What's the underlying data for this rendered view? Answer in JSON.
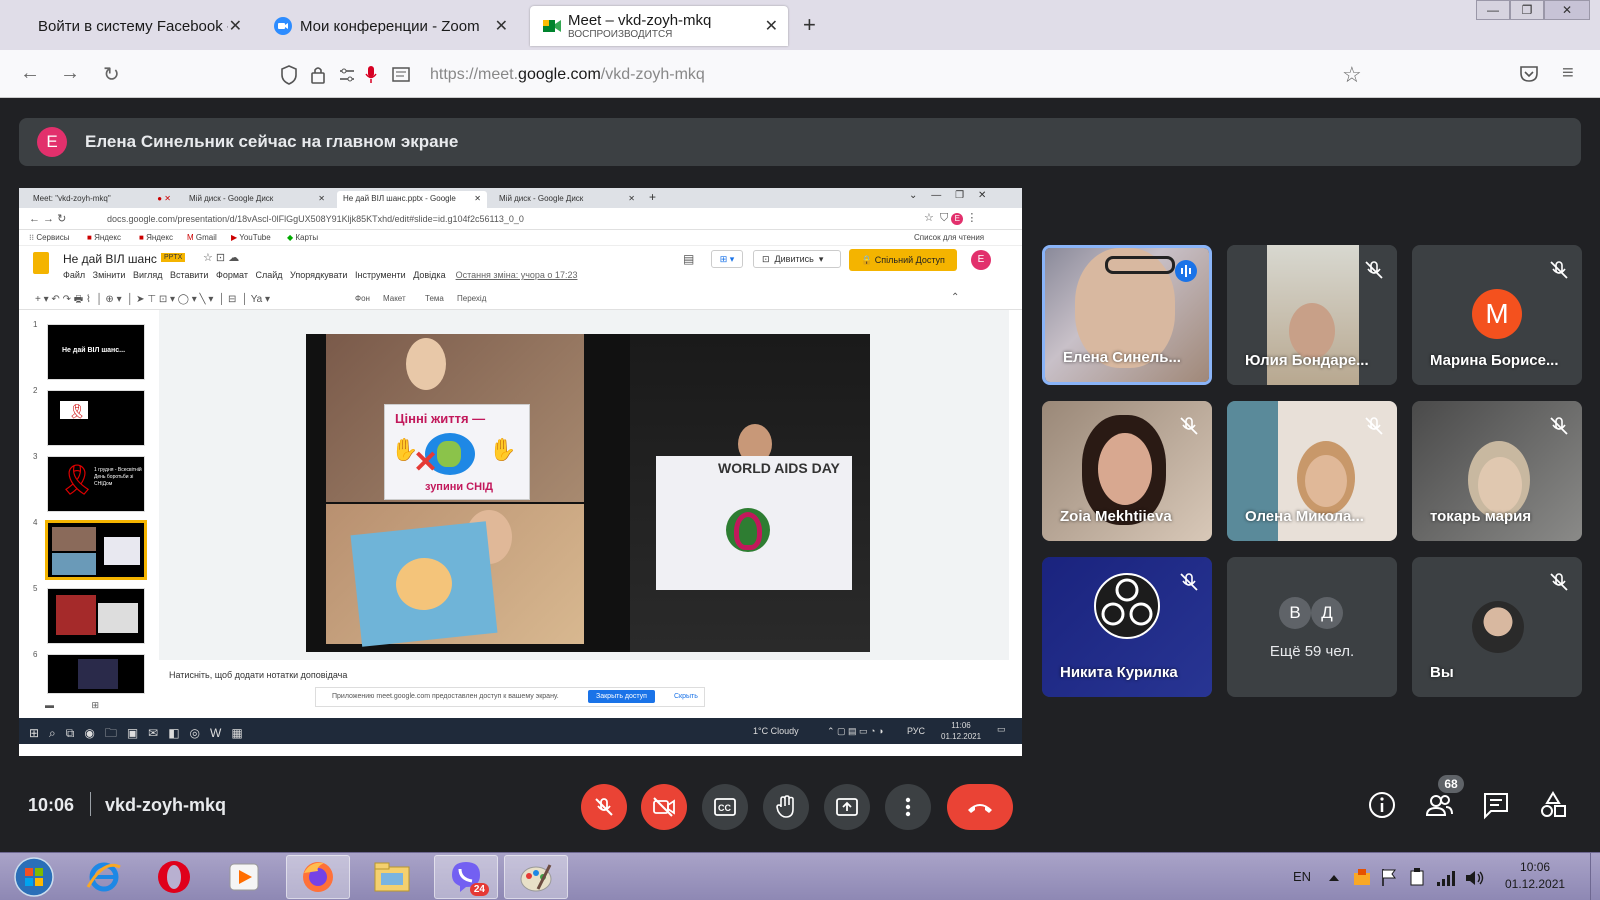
{
  "browser": {
    "tabs": [
      {
        "title": "Войти в систему Facebook - Zo",
        "icon": "facebook-icon"
      },
      {
        "title": "Мои конференции - Zoom",
        "icon": "zoom-icon"
      },
      {
        "title": "Meet – vkd-zoyh-mkq",
        "subtitle": "ВОСПРОИЗВОДИТСЯ",
        "icon": "meet-icon"
      }
    ],
    "new_tab_label": "+",
    "url_prefix": "https://meet.",
    "url_domain": "google.com",
    "url_path": "/vkd-zoyh-mkq"
  },
  "banner": {
    "avatar_letter": "E",
    "text": "Елена Синельник сейчас на главном экране"
  },
  "presentation": {
    "tabs": [
      "Meet: \"vkd-zoyh-mkq\"",
      "Мій диск - Google Диск",
      "Не дай ВІЛ шанс.pptx - Google",
      "Мій диск - Google Диск"
    ],
    "address": "docs.google.com/presentation/d/18vAscl-0lFlGgUX508Y91Kljk85KTxhd/edit#slide=id.g104f2c56113_0_0",
    "bookmarks": [
      "Сервисы",
      "Яндекс",
      "Яндекс",
      "Gmail",
      "YouTube",
      "Карты"
    ],
    "reading_list": "Список для чтения",
    "doc_title": "Не дай ВІЛ шанс",
    "doc_badge": "PPTX",
    "menu": [
      "Файл",
      "Змінити",
      "Вигляд",
      "Вставити",
      "Формат",
      "Слайд",
      "Упорядкувати",
      "Інструменти",
      "Довідка"
    ],
    "last_edit": "Остання зміна: учора о 17:23",
    "view_button": "Дивитись",
    "share_button": "Спільний Доступ",
    "user_avatar": "E",
    "toolbar_items": [
      "Фон",
      "Макет",
      "Тема",
      "Перехід"
    ],
    "slide_numbers": [
      "1",
      "2",
      "3",
      "4",
      "5",
      "6"
    ],
    "slide1_text": "Не дай ВІЛ шанс...",
    "slide3_text": "1 грудня - Всесвітній День боротьби зі СНІДом",
    "poster_text_1": "Цінні життя —",
    "poster_text_2": "зупини СНІД",
    "poster_text_3": "WORLD AIDS DAY",
    "notes_placeholder": "Натисніть, щоб додати нотатки доповідача",
    "share_notice": "Приложению meet.google.com предоставлен доступ к вашему экрану.",
    "stop_sharing": "Закрыть доступ",
    "hide": "Скрыть",
    "weather": "1°C Cloudy",
    "lang": "РУС",
    "time": "11:06",
    "date": "01.12.2021"
  },
  "participants": [
    {
      "name": "Елена Синель...",
      "speaking": true,
      "muted": false
    },
    {
      "name": "Юлия Бондаре...",
      "muted": true
    },
    {
      "name": "Марина Борисе...",
      "avatar_letter": "M",
      "avatar_color": "#f4511e",
      "muted": true
    },
    {
      "name": "Zoia Mekhtiieva",
      "muted": true
    },
    {
      "name": "Олена Микола...",
      "muted": true
    },
    {
      "name": "токарь мария",
      "muted": true
    },
    {
      "name": "Никита Курилка",
      "muted": true
    },
    {
      "name": "Ещё 59 чел.",
      "avatar_letters": [
        "В",
        "Д"
      ]
    },
    {
      "name": "Вы",
      "muted": true
    }
  ],
  "controls": {
    "time": "10:06",
    "meeting_code": "vkd-zoyh-mkq",
    "people_count": "68"
  },
  "taskbar": {
    "apps": [
      "windows-start-icon",
      "internet-explorer-icon",
      "opera-icon",
      "media-player-icon",
      "firefox-icon",
      "file-explorer-icon",
      "viber-icon",
      "paint-icon"
    ],
    "viber_badge": "24",
    "lang": "EN",
    "time": "10:06",
    "date": "01.12.2021"
  }
}
